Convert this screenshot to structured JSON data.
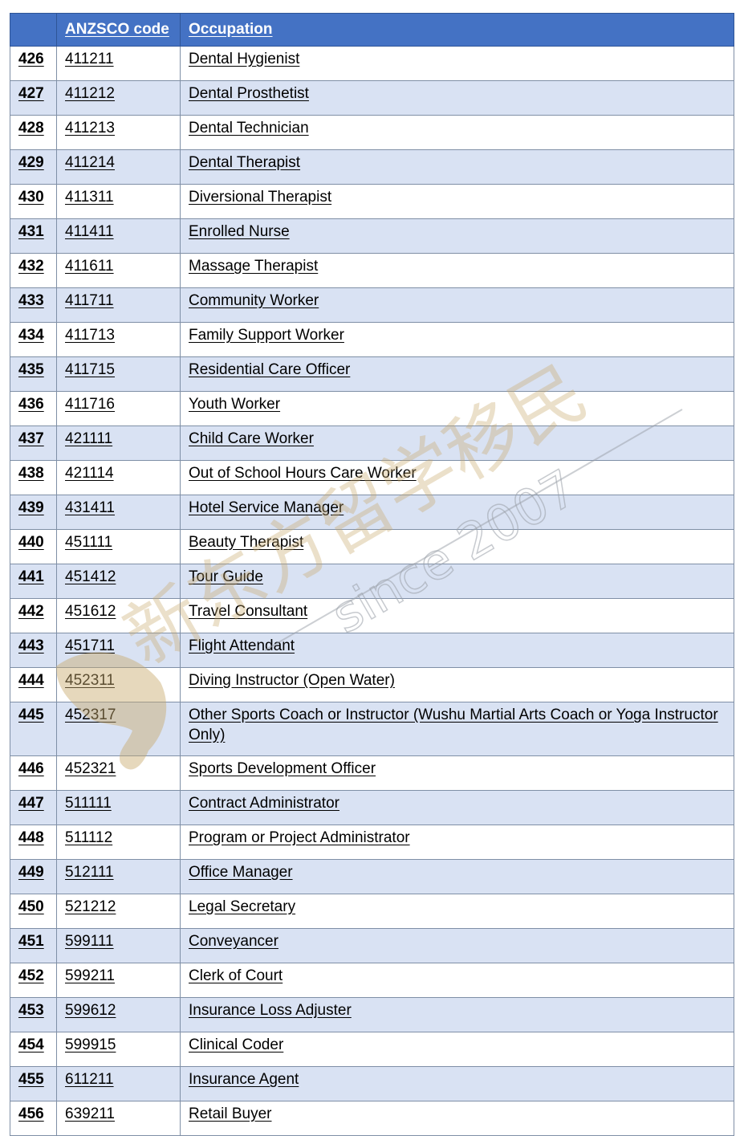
{
  "table": {
    "headers": [
      "",
      "ANZSCO code",
      "Occupation"
    ],
    "rows": [
      {
        "num": "426",
        "code": "411211",
        "occupation": "Dental Hygienist"
      },
      {
        "num": "427",
        "code": "411212",
        "occupation": "Dental Prosthetist"
      },
      {
        "num": "428",
        "code": "411213",
        "occupation": "Dental Technician"
      },
      {
        "num": "429",
        "code": "411214",
        "occupation": "Dental Therapist"
      },
      {
        "num": "430",
        "code": "411311",
        "occupation": "Diversional Therapist"
      },
      {
        "num": "431",
        "code": "411411",
        "occupation": "Enrolled Nurse"
      },
      {
        "num": "432",
        "code": "411611",
        "occupation": "Massage Therapist"
      },
      {
        "num": "433",
        "code": "411711",
        "occupation": "Community Worker"
      },
      {
        "num": "434",
        "code": "411713",
        "occupation": "Family Support Worker"
      },
      {
        "num": "435",
        "code": "411715",
        "occupation": "Residential Care Officer"
      },
      {
        "num": "436",
        "code": "411716",
        "occupation": "Youth Worker"
      },
      {
        "num": "437",
        "code": "421111",
        "occupation": "Child Care Worker"
      },
      {
        "num": "438",
        "code": "421114",
        "occupation": "Out of School Hours Care Worker"
      },
      {
        "num": "439",
        "code": "431411",
        "occupation": "Hotel Service Manager"
      },
      {
        "num": "440",
        "code": "451111",
        "occupation": "Beauty Therapist"
      },
      {
        "num": "441",
        "code": "451412",
        "occupation": "Tour Guide"
      },
      {
        "num": "442",
        "code": "451612",
        "occupation": "Travel Consultant"
      },
      {
        "num": "443",
        "code": "451711",
        "occupation": "Flight Attendant"
      },
      {
        "num": "444",
        "code": "452311",
        "occupation": "Diving Instructor (Open Water)"
      },
      {
        "num": "445",
        "code": "452317",
        "occupation": "Other Sports Coach or Instructor (Wushu Martial Arts Coach or Yoga Instructor Only)"
      },
      {
        "num": "446",
        "code": "452321",
        "occupation": "Sports Development Officer"
      },
      {
        "num": "447",
        "code": "511111",
        "occupation": "Contract Administrator"
      },
      {
        "num": "448",
        "code": "511112",
        "occupation": "Program or Project Administrator"
      },
      {
        "num": "449",
        "code": "512111",
        "occupation": "Office Manager"
      },
      {
        "num": "450",
        "code": "521212",
        "occupation": "Legal Secretary"
      },
      {
        "num": "451",
        "code": "599111",
        "occupation": "Conveyancer"
      },
      {
        "num": "452",
        "code": "599211",
        "occupation": "Clerk of Court"
      },
      {
        "num": "453",
        "code": "599612",
        "occupation": "Insurance Loss Adjuster"
      },
      {
        "num": "454",
        "code": "599915",
        "occupation": "Clinical Coder"
      },
      {
        "num": "455",
        "code": "611211",
        "occupation": "Insurance Agent"
      },
      {
        "num": "456",
        "code": "639211",
        "occupation": "Retail Buyer"
      }
    ]
  },
  "watermark": {
    "text_latin": "since 2007",
    "text_cjk": "新东方留学移民",
    "logo": "kangaroo-logo"
  },
  "colors": {
    "header_bg": "#4472C4",
    "header_text": "#FFFFFF",
    "alt_row_bg": "#D9E2F3",
    "border": "#7F8FA6",
    "watermark": "#C8A86A"
  }
}
